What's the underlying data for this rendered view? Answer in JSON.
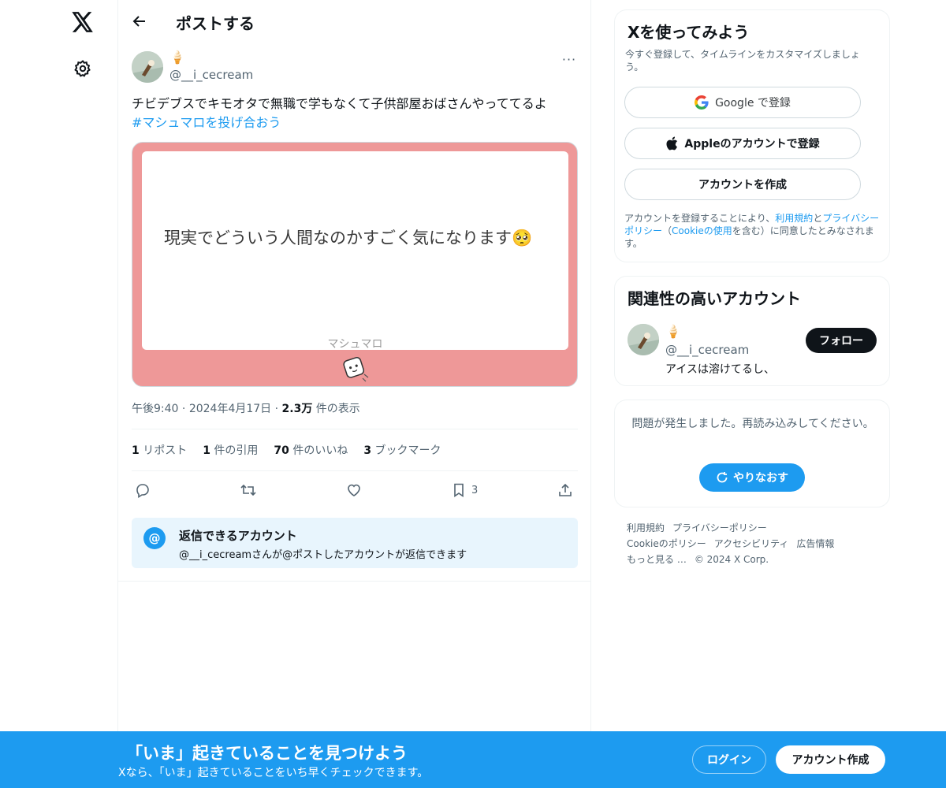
{
  "nav": {
    "logo_icon": "x-logo-icon",
    "settings_icon": "gear-icon"
  },
  "header": {
    "back_icon": "arrow-left-icon",
    "title": "ポストする"
  },
  "post": {
    "display_name": "🍦",
    "handle": "@__i_cecream",
    "more_icon": "more-icon",
    "more_label": "···",
    "text": "チビデブスでキモオタで無職で学もなくて子供部屋おばさんやっててるよ",
    "hashtag": "#マシュマロを投げ合おう",
    "card": {
      "question": "現実でどういう人間なのかすごく気になります🥺",
      "brand": "マシュマロ",
      "bg_color": "#ee9898"
    },
    "meta": {
      "time": "午後9:40",
      "dot1": "·",
      "date": "2024年4月17日",
      "dot2": "·",
      "views_value": "2.3万",
      "views_label": "件の表示"
    },
    "stats": {
      "reposts_value": "1",
      "reposts_label": "リポスト",
      "quotes_value": "1",
      "quotes_label": "件の引用",
      "likes_value": "70",
      "likes_label": "件のいいね",
      "bookmarks_value": "3",
      "bookmarks_label": "ブックマーク"
    },
    "actions": {
      "bookmark_count": "3"
    },
    "reply_info": {
      "icon_label": "@",
      "title": "返信できるアカウント",
      "desc": "@__i_cecreamさんが@ポストしたアカウントが返信できます"
    }
  },
  "sidebar": {
    "signup": {
      "title": "Xを使ってみよう",
      "subtitle": "今すぐ登録して、タイムラインをカスタマイズしましょう。",
      "google_label": "Google で登録",
      "apple_label": "Appleのアカウントで登録",
      "create_label": "アカウントを作成",
      "legal_pre": "アカウントを登録することにより、",
      "legal_terms": "利用規約",
      "legal_and": "と",
      "legal_privacy": "プライバシーポリシー",
      "legal_open": "（",
      "legal_cookie": "Cookieの使用",
      "legal_post": "を含む）に同意したとみなされます。"
    },
    "related": {
      "title": "関連性の高いアカウント",
      "name": "🍦",
      "handle": "@__i_cecream",
      "bio": "アイスは溶けてるし、",
      "follow_label": "フォロー"
    },
    "error": {
      "message": "問題が発生しました。再読み込みしてください。",
      "retry_label": "やりなおす"
    },
    "footer": {
      "terms": "利用規約",
      "privacy": "プライバシーポリシー",
      "cookie": "Cookieのポリシー",
      "accessibility": "アクセシビリティ",
      "ads": "広告情報",
      "more": "もっと見る …",
      "copyright": "© 2024 X Corp."
    }
  },
  "banner": {
    "title": "「いま」起きていることを見つけよう",
    "subtitle": "Xなら、「いま」起きていることをいち早くチェックできます。",
    "login_label": "ログイン",
    "signup_label": "アカウント作成",
    "bg_color": "#1d9bf0"
  }
}
